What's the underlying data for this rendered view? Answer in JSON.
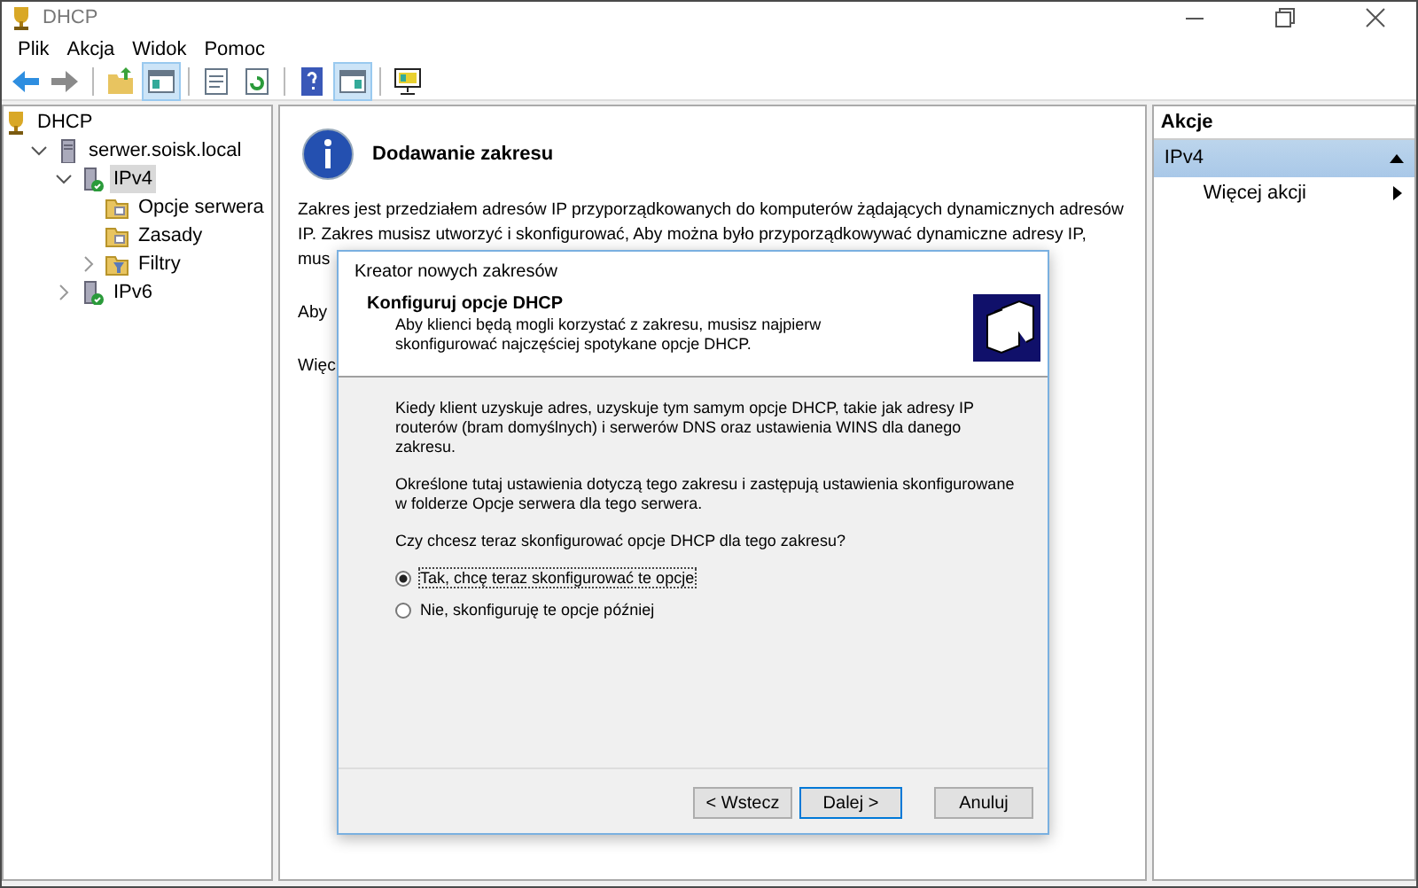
{
  "window": {
    "title": "DHCP"
  },
  "menu": [
    "Plik",
    "Akcja",
    "Widok",
    "Pomoc"
  ],
  "toolbar": [
    {
      "kind": "back",
      "pressed": false
    },
    {
      "kind": "forward",
      "pressed": false
    },
    {
      "kind": "sep"
    },
    {
      "kind": "up",
      "pressed": false
    },
    {
      "kind": "tree",
      "pressed": true
    },
    {
      "kind": "sep"
    },
    {
      "kind": "props",
      "pressed": false
    },
    {
      "kind": "refresh",
      "pressed": false
    },
    {
      "kind": "sep"
    },
    {
      "kind": "help",
      "pressed": false
    },
    {
      "kind": "pane",
      "pressed": true
    },
    {
      "kind": "sep"
    },
    {
      "kind": "monitor",
      "pressed": false
    }
  ],
  "tree": [
    {
      "label": "DHCP",
      "kind": "root",
      "selected": false,
      "children": [
        {
          "label": "serwer.soisk.local",
          "kind": "server",
          "expanded": true,
          "selected": false,
          "children": [
            {
              "label": "IPv4",
              "kind": "ip",
              "expanded": true,
              "selected": true,
              "children": [
                {
                  "label": "Opcje serwera",
                  "kind": "folder",
                  "selected": false
                },
                {
                  "label": "Zasady",
                  "kind": "folder",
                  "selected": false
                },
                {
                  "label": "Filtry",
                  "kind": "filter",
                  "expanded": false,
                  "selected": false
                }
              ]
            },
            {
              "label": "IPv6",
              "kind": "ip",
              "expanded": false,
              "selected": false
            }
          ]
        }
      ]
    }
  ],
  "content": {
    "heading": "Dodawanie zakresu",
    "paragraphs": [
      "Zakres jest przedziałem adresów IP przyporządkowanych do komputerów żądających dynamicznych adresów",
      "IP. Zakres musisz utworzyć i skonfigurować, Aby można było przyporządkowywać dynamiczne adresy IP,",
      "mus",
      "Aby",
      "Więc"
    ]
  },
  "actions": {
    "title": "Akcje",
    "section": "IPv4",
    "items": [
      "Więcej akcji"
    ]
  },
  "dialog": {
    "title": "Kreator nowych zakresów",
    "heading": "Konfiguruj opcje DHCP",
    "subheading": "Aby klienci będą mogli korzystać z zakresu, musisz najpierw skonfigurować najczęściej spotykane opcje DHCP.",
    "paragraphs": [
      "Kiedy klient uzyskuje adres, uzyskuje tym samym opcje DHCP, takie jak adresy IP routerów (bram domyślnych) i serwerów DNS oraz ustawienia WINS dla danego zakresu.",
      "Określone tutaj ustawienia dotyczą tego zakresu i zastępują ustawienia skonfigurowane w folderze Opcje serwera dla tego serwera.",
      "Czy chcesz teraz skonfigurować opcje DHCP dla tego zakresu?"
    ],
    "options": [
      {
        "label": "Tak, chcę teraz skonfigurować te opcje",
        "selected": true
      },
      {
        "label": "Nie, skonfiguruję te opcje później",
        "selected": false
      }
    ],
    "buttons": [
      {
        "label": "< Wstecz",
        "default": false
      },
      {
        "label": "Dalej >",
        "default": true
      },
      {
        "label": "Anuluj",
        "default": false
      }
    ]
  }
}
